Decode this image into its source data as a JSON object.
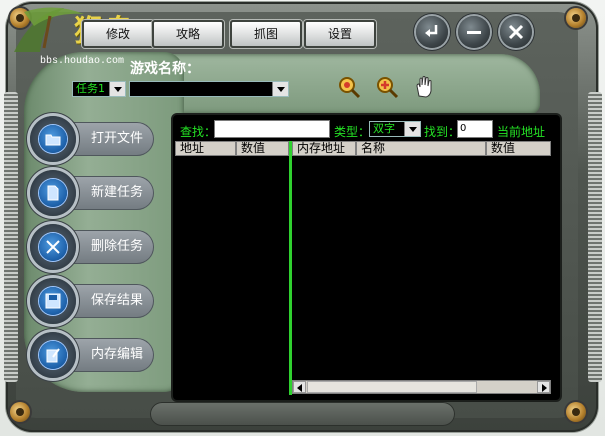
{
  "logo": {
    "text": "猴岛",
    "url": "bbs.houdao.com"
  },
  "tabs": [
    {
      "label": "修改"
    },
    {
      "label": "攻略"
    },
    {
      "label": "抓图"
    },
    {
      "label": "设置"
    }
  ],
  "game_name_label": "游戏名称：",
  "task_select": {
    "value": "任务1"
  },
  "game_select": {
    "value": ""
  },
  "sidebar": {
    "buttons": [
      {
        "label": "打开文件",
        "icon": "folder-icon"
      },
      {
        "label": "新建任务",
        "icon": "new-file-icon"
      },
      {
        "label": "删除任务",
        "icon": "delete-icon"
      },
      {
        "label": "保存结果",
        "icon": "disk-icon"
      },
      {
        "label": "内存编辑",
        "icon": "edit-icon"
      }
    ]
  },
  "search": {
    "label": "查找：",
    "value": "",
    "type_label": "类型：",
    "type_value": "双字",
    "found_label": "找到：",
    "found_value": "0",
    "current_address_label": "当前地址"
  },
  "left_table": {
    "columns": [
      "地址",
      "数值"
    ]
  },
  "right_table": {
    "columns": [
      "内存地址",
      "名称",
      "数值"
    ]
  },
  "colors": {
    "accent_green": "#25e325",
    "panel_green": "#7d997d"
  }
}
